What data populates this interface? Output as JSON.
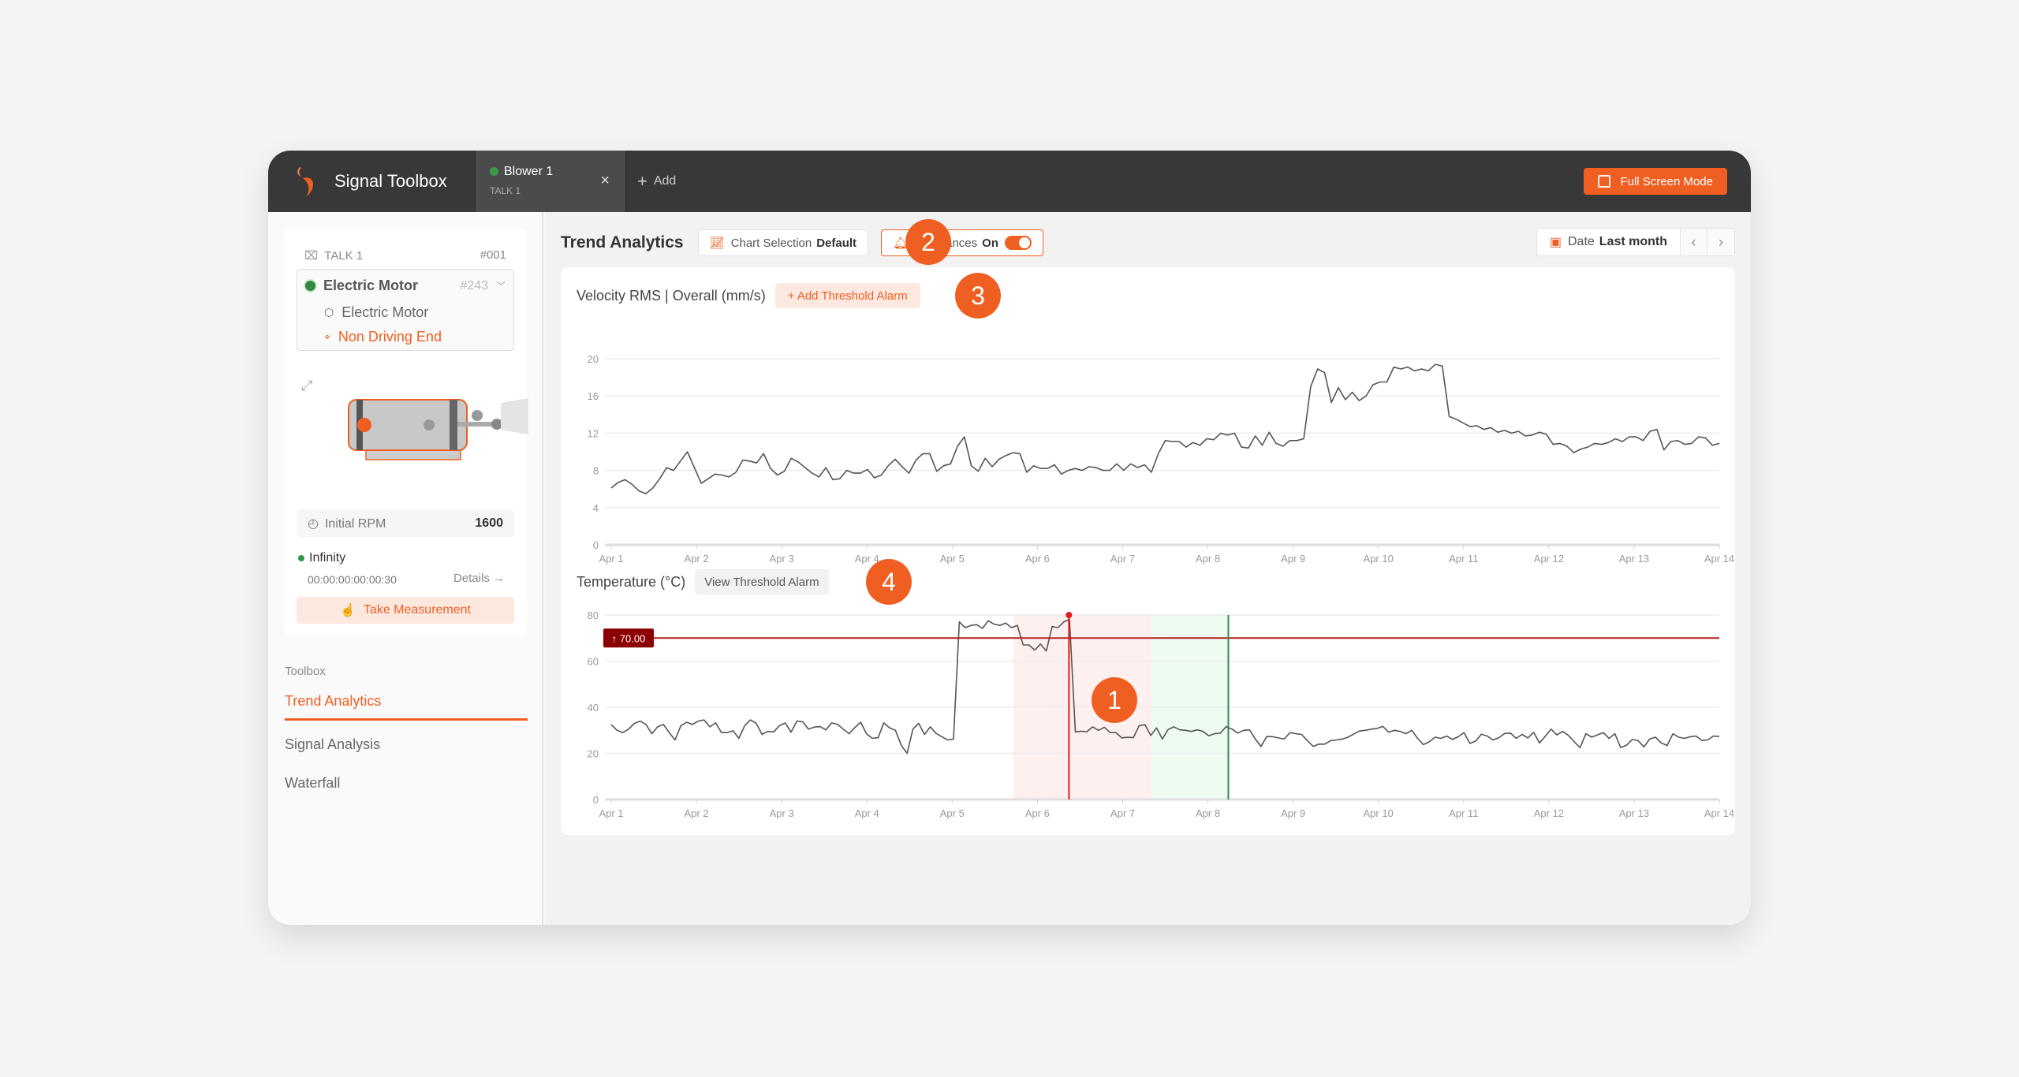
{
  "app": {
    "name": "Signal Toolbox",
    "fullscreen_label": "Full Screen Mode",
    "add_tab_label": "Add"
  },
  "tabs": [
    {
      "title": "Blower 1",
      "subtitle": "TALK 1",
      "status_color": "#3c9a4a"
    }
  ],
  "sidebar": {
    "talk_label": "TALK 1",
    "talk_id": "#001",
    "asset": {
      "name": "Electric Motor",
      "id": "#243",
      "component": "Electric Motor",
      "location": "Non Driving End"
    },
    "rpm_label": "Initial RPM",
    "rpm_value": "1600",
    "status_label": "Infinity",
    "timer": "00:00:00:00:00:30",
    "details_label": "Details →",
    "measure_label": "Take Measurement",
    "toolbox_label": "Toolbox",
    "nav": [
      {
        "label": "Trend Analytics",
        "active": true
      },
      {
        "label": "Signal Analysis",
        "active": false
      },
      {
        "label": "Waterfall",
        "active": false
      }
    ]
  },
  "toolbar": {
    "title": "Trend Analytics",
    "chart_selection_label": "Chart Selection",
    "chart_selection_value": "Default",
    "occurances_label": "Occurances",
    "occurances_value": "On",
    "occurances_on": true,
    "date_label": "Date",
    "date_value": "Last month"
  },
  "badges": {
    "b1": "1",
    "b2": "2",
    "b3": "3",
    "b4": "4"
  },
  "colors": {
    "accent": "#ef5f22",
    "threshold": "#b22222",
    "occurrence_start": "#e21b1b",
    "occurrence_end": "#3c8a4a"
  },
  "velocity_chart": {
    "title": "Velocity RMS | Overall (mm/s)",
    "action_label": "+ Add Threshold Alarm"
  },
  "temperature_chart": {
    "title": "Temperature (°C)",
    "action_label": "View Threshold Alarm",
    "threshold_label": "↑ 70.00"
  },
  "chart_data": [
    {
      "type": "line",
      "title": "Velocity RMS | Overall (mm/s)",
      "xlabel": "",
      "ylabel": "",
      "x_ticks": [
        "Apr 1",
        "Apr 2",
        "Apr 3",
        "Apr 4",
        "Apr 5",
        "Apr 6",
        "Apr 7",
        "Apr 8",
        "Apr 9",
        "Apr 10",
        "Apr 11",
        "Apr 12",
        "Apr 13",
        "Apr 14"
      ],
      "y_ticks": [
        0,
        4,
        8,
        12,
        16,
        20
      ],
      "ylim": [
        0,
        20
      ],
      "xlim": [
        0,
        13
      ],
      "grid": true,
      "series": [
        {
          "name": "Velocity RMS",
          "values": [
            6.1,
            6.7,
            7.0,
            6.5,
            5.8,
            5.5,
            6.1,
            7.1,
            8.3,
            8.0,
            9.0,
            10.0,
            8.3,
            6.6,
            7.1,
            7.6,
            7.5,
            7.3,
            7.8,
            9.1,
            9.0,
            8.8,
            9.8,
            8.2,
            7.5,
            7.9,
            9.3,
            8.9,
            8.3,
            7.7,
            7.3,
            8.3,
            7.0,
            7.1,
            8.0,
            7.7,
            7.7,
            8.1,
            7.2,
            7.5,
            8.5,
            9.2,
            8.4,
            7.7,
            9.1,
            9.8,
            9.8,
            7.9,
            8.5,
            8.7,
            10.6,
            11.6,
            8.5,
            7.9,
            9.3,
            8.4,
            9.2,
            9.6,
            9.9,
            9.8,
            7.8,
            8.5,
            8.2,
            8.2,
            8.6,
            7.6,
            8.0,
            8.2,
            8.0,
            8.4,
            8.3,
            8.0,
            8.0,
            8.7,
            8.0,
            8.7,
            8.3,
            8.6,
            7.8,
            9.8,
            11.2,
            11.1,
            11.1,
            10.5,
            11.0,
            10.7,
            11.4,
            11.3,
            12.0,
            11.8,
            12.0,
            10.5,
            10.4,
            11.7,
            10.7,
            12.1,
            10.9,
            10.6,
            11.2,
            11.2,
            11.4,
            17.0,
            18.9,
            18.5,
            15.3,
            16.9,
            15.6,
            16.4,
            15.5,
            16.0,
            17.2,
            17.5,
            17.5,
            19.1,
            18.9,
            19.1,
            18.7,
            18.9,
            18.7,
            19.4,
            19.2,
            13.8,
            13.5,
            13.1,
            12.7,
            12.8,
            12.4,
            12.6,
            12.1,
            12.3,
            12.0,
            12.2,
            11.7,
            11.8,
            12.1,
            11.9,
            10.8,
            10.9,
            10.6,
            9.9,
            10.3,
            10.5,
            10.9,
            10.8,
            11.0,
            11.4,
            11.1,
            11.6,
            11.6,
            11.2,
            12.2,
            12.4,
            10.2,
            11.1,
            11.2,
            10.8,
            10.9,
            11.6,
            11.5,
            10.7,
            10.9
          ]
        }
      ]
    },
    {
      "type": "line",
      "title": "Temperature (°C)",
      "xlabel": "",
      "ylabel": "",
      "x_ticks": [
        "Apr 1",
        "Apr 2",
        "Apr 3",
        "Apr 4",
        "Apr 5",
        "Apr 6",
        "Apr 7",
        "Apr 8",
        "Apr 9",
        "Apr 10",
        "Apr 11",
        "Apr 12",
        "Apr 13",
        "Apr 14"
      ],
      "y_ticks": [
        0,
        20,
        40,
        60,
        80
      ],
      "ylim": [
        0,
        80
      ],
      "xlim": [
        0,
        13
      ],
      "grid": true,
      "annotations": [
        {
          "type": "threshold",
          "label": "↑ 70.00",
          "y": 70
        },
        {
          "type": "occurrence-band",
          "x_start": 4.72,
          "x_end": 6.34,
          "color": "red"
        },
        {
          "type": "recovery-band",
          "x_start": 6.34,
          "x_end": 7.24,
          "color": "green"
        },
        {
          "type": "marker-line",
          "x": 5.37,
          "color": "red"
        },
        {
          "type": "marker-line",
          "x": 7.24,
          "color": "green"
        }
      ],
      "series": [
        {
          "name": "Temperature",
          "values": [
            32.5,
            30,
            29,
            30.5,
            33,
            34,
            32.5,
            28.5,
            31.5,
            32.5,
            29,
            25.8,
            32,
            33.5,
            32.5,
            34,
            34.5,
            31.5,
            33.2,
            29,
            29,
            29.8,
            26.5,
            32,
            34.5,
            33,
            28.2,
            29.5,
            29.3,
            32,
            33.2,
            29.2,
            34,
            33.7,
            30.5,
            31.4,
            31.6,
            30.2,
            33.2,
            32.6,
            30.5,
            28.5,
            31.2,
            33.5,
            28.5,
            26.5,
            26.8,
            33.2,
            31,
            30,
            23.5,
            20,
            30.5,
            33,
            28.2,
            31.5,
            28.6,
            27.2,
            25.8,
            26.2,
            77,
            74.5,
            75.5,
            75.8,
            74.2,
            77.5,
            76,
            75.5,
            76.5,
            74.5,
            75.5,
            67,
            67,
            64.8,
            67.4,
            64.4,
            75,
            74.5,
            77,
            78,
            29.3,
            29.6,
            29.4,
            31.5,
            30,
            31.3,
            29,
            29,
            26.7,
            27,
            26.8,
            32,
            32.4,
            27.8,
            31,
            26.2,
            30.4,
            31.5,
            30.2,
            30,
            29.5,
            30.2,
            29.5,
            27.6,
            28.5,
            28.8,
            31.6,
            30.5,
            28.8,
            30,
            30.2,
            26.3,
            23,
            27.3,
            27.2,
            26.7,
            26.2,
            29,
            28.5,
            28.2,
            25.5,
            23,
            24,
            24,
            25.5,
            25.8,
            26.2,
            27,
            28.4,
            29.7,
            30,
            30.5,
            30.8,
            31.7,
            29.2,
            30,
            29.5,
            28.5,
            30,
            26.5,
            23.8,
            25,
            27,
            26.5,
            27.5,
            26,
            27.2,
            29,
            24.3,
            25.3,
            28.3,
            27.5,
            25.8,
            26.8,
            28.6,
            28.8,
            26.5,
            28.2,
            26.7,
            29.1,
            24.5,
            27.4,
            30.5,
            28,
            29.5,
            27.8,
            25,
            22.5,
            28.5,
            27,
            28,
            29,
            26.5,
            28.5,
            22.5,
            23.5,
            26,
            25.5,
            22.8,
            26.2,
            27,
            24.5,
            23.4,
            28.5,
            27,
            26.5,
            27.2,
            27.5,
            25.6,
            25.8,
            27.5,
            27.3
          ]
        }
      ]
    }
  ]
}
